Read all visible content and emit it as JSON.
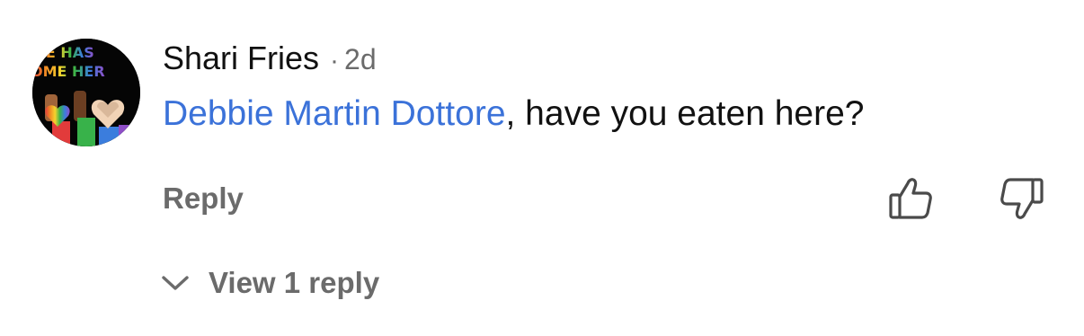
{
  "comment": {
    "author": "Shari Fries",
    "separator": "·",
    "timestamp": "2d",
    "mention": "Debbie Martin Dottore",
    "text": ", have you eaten here?",
    "mention_color": "#3b72d9"
  },
  "avatar": {
    "line1": "TE HAS",
    "line2": "OME HER",
    "colors": [
      "#e23b3b",
      "#f08a24",
      "#f6d32d",
      "#38b24a",
      "#3b7ddd",
      "#8e4ec6"
    ]
  },
  "actions": {
    "reply_label": "Reply",
    "like_icon": "thumbs-up-icon",
    "dislike_icon": "thumbs-down-icon"
  },
  "replies": {
    "toggle_icon": "chevron-down-icon",
    "label": "View 1 reply"
  },
  "colors": {
    "text_primary": "#111111",
    "text_secondary": "#6b6b6b",
    "link": "#3b72d9"
  }
}
